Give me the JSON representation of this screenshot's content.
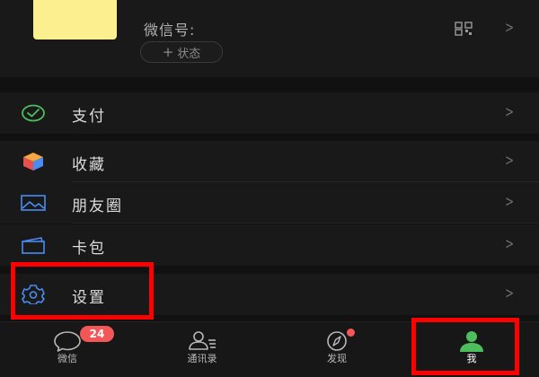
{
  "profile": {
    "wechat_id_label": "微信号:",
    "status_label": "状态",
    "plus_glyph": "+",
    "avatar_color": "#fbef8f",
    "qr_icon": "qr-code-icon",
    "chevron": ">"
  },
  "menu": {
    "items": [
      {
        "label": "支付",
        "icon": "payment-icon",
        "color": "#4dbd5e"
      },
      {
        "label": "收藏",
        "icon": "favorites-cube-icon",
        "color": "#f5a742"
      },
      {
        "label": "朋友圈",
        "icon": "moments-picture-icon",
        "color": "#4a8cf0"
      },
      {
        "label": "卡包",
        "icon": "cards-wallet-icon",
        "color": "#4a8cf0"
      },
      {
        "label": "设置",
        "icon": "settings-gear-icon",
        "color": "#4a8cf0"
      }
    ],
    "chevron": ">"
  },
  "tabbar": {
    "tabs": [
      {
        "label": "微信",
        "icon": "chat-bubble-icon",
        "badge": "24"
      },
      {
        "label": "通讯录",
        "icon": "contacts-icon"
      },
      {
        "label": "发现",
        "icon": "compass-icon",
        "badge_dot": true
      },
      {
        "label": "我",
        "icon": "me-person-icon",
        "active": true
      }
    ],
    "active_color": "#4dbd5e",
    "badge_color": "#f25757"
  },
  "highlight_color": "#ff0000"
}
